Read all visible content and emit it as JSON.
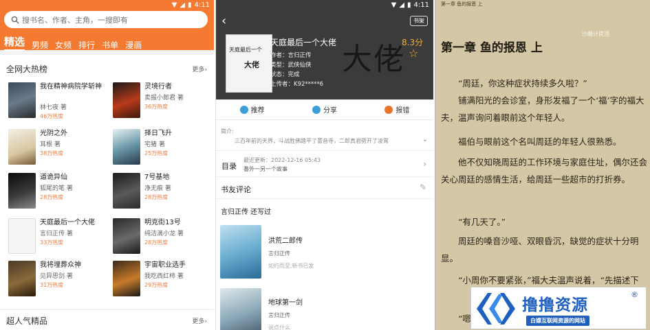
{
  "p1": {
    "status_time": "4:11",
    "search_placeholder": "搜书名、作者、主角，一搜即有",
    "tabs": [
      "精选",
      "男频",
      "女频",
      "排行",
      "书单",
      "漫画"
    ],
    "section1": "全网大热榜",
    "section1_more": "更多›",
    "books": [
      {
        "title": "我在精神病院学斩神",
        "author": "林七夜 著",
        "hot": "46万热度"
      },
      {
        "title": "灵境行者",
        "author": "卖报小郎君 著",
        "hot": "36万热度"
      },
      {
        "title": "光阴之外",
        "author": "耳根 著",
        "hot": "38万热度"
      },
      {
        "title": "择日飞升",
        "author": "宅猪 著",
        "hot": "25万热度"
      },
      {
        "title": "道诡异仙",
        "author": "狐尾的笔 著",
        "hot": "28万热度"
      },
      {
        "title": "7号基地",
        "author": "净无痕 著",
        "hot": "28万热度"
      },
      {
        "title": "天庭最后一个大佬",
        "author": "言归正传 著",
        "hot": "33万热度"
      },
      {
        "title": "明克街13号",
        "author": "纯洁滴小龙 著",
        "hot": "28万热度"
      },
      {
        "title": "我将埋葬众神",
        "author": "见异思剑 著",
        "hot": "31万热度"
      },
      {
        "title": "宇宙职业选手",
        "author": "我吃西红柿 著",
        "hot": "29万热度"
      }
    ],
    "section2": "超人气精品",
    "section2_more": "更多›"
  },
  "p2": {
    "status_time": "4:11",
    "shelf": "书架",
    "title": "天庭最后一个大佬",
    "score": "8.3分",
    "author": "作者：言归正传",
    "type": "类型：武侠仙侠",
    "state": "状态：完成",
    "uploader": "上传者：K92*****6",
    "cover_text1": "天庭最后一个",
    "cover_text2": "大佬",
    "big_text": "大佬",
    "actions": [
      "推荐",
      "分享",
      "报错"
    ],
    "intro_label": "简介:",
    "intro": "三百年前的天界，斗战胜佛踏平了蕾音寺，二郎真君劈开了凌霄",
    "toc_label": "目录",
    "toc_update": "最近更新：2022-12-16 05:43",
    "toc_latest": "番外一另一个故事",
    "comments": "书友评论",
    "also_by": "言归正传  还写过",
    "other_books": [
      {
        "title": "洪荒二郎传",
        "author": "言归正传",
        "desc": "如约而至,新书已发"
      },
      {
        "title": "地球第一剑",
        "author": "言归正传",
        "desc": "说点什么"
      }
    ]
  },
  "p3": {
    "top": "第一章 鱼的报恩 上",
    "watermark": "沙雕计提活",
    "chapter": "第一章 鱼的报恩 上",
    "paras": [
      "“周廷，你这种症状持续多久啦？”",
      "铺满阳光的会诊室，身形发福了一个‘福’字的福大夫，温声询问着眼前这个年轻人。",
      "福伯与眼前这个名叫周廷的年轻人很熟悉。",
      "他不仅知晓周廷的工作环境与家庭住址，偶尔还会关心周廷的感情生活，给周廷一些超市的打折券。",
      "“有几天了。”",
      "周廷的嗓音沙哑、双眼昏沉，缺觉的症状十分明显。",
      "“小周你不要紧张，”福大夫温声说着，“先描述下自己",
      "“嗯"
    ]
  },
  "logo": {
    "name": "撸撸资源",
    "reg": "®",
    "slogan": "白嫖互联网资源的网站"
  }
}
